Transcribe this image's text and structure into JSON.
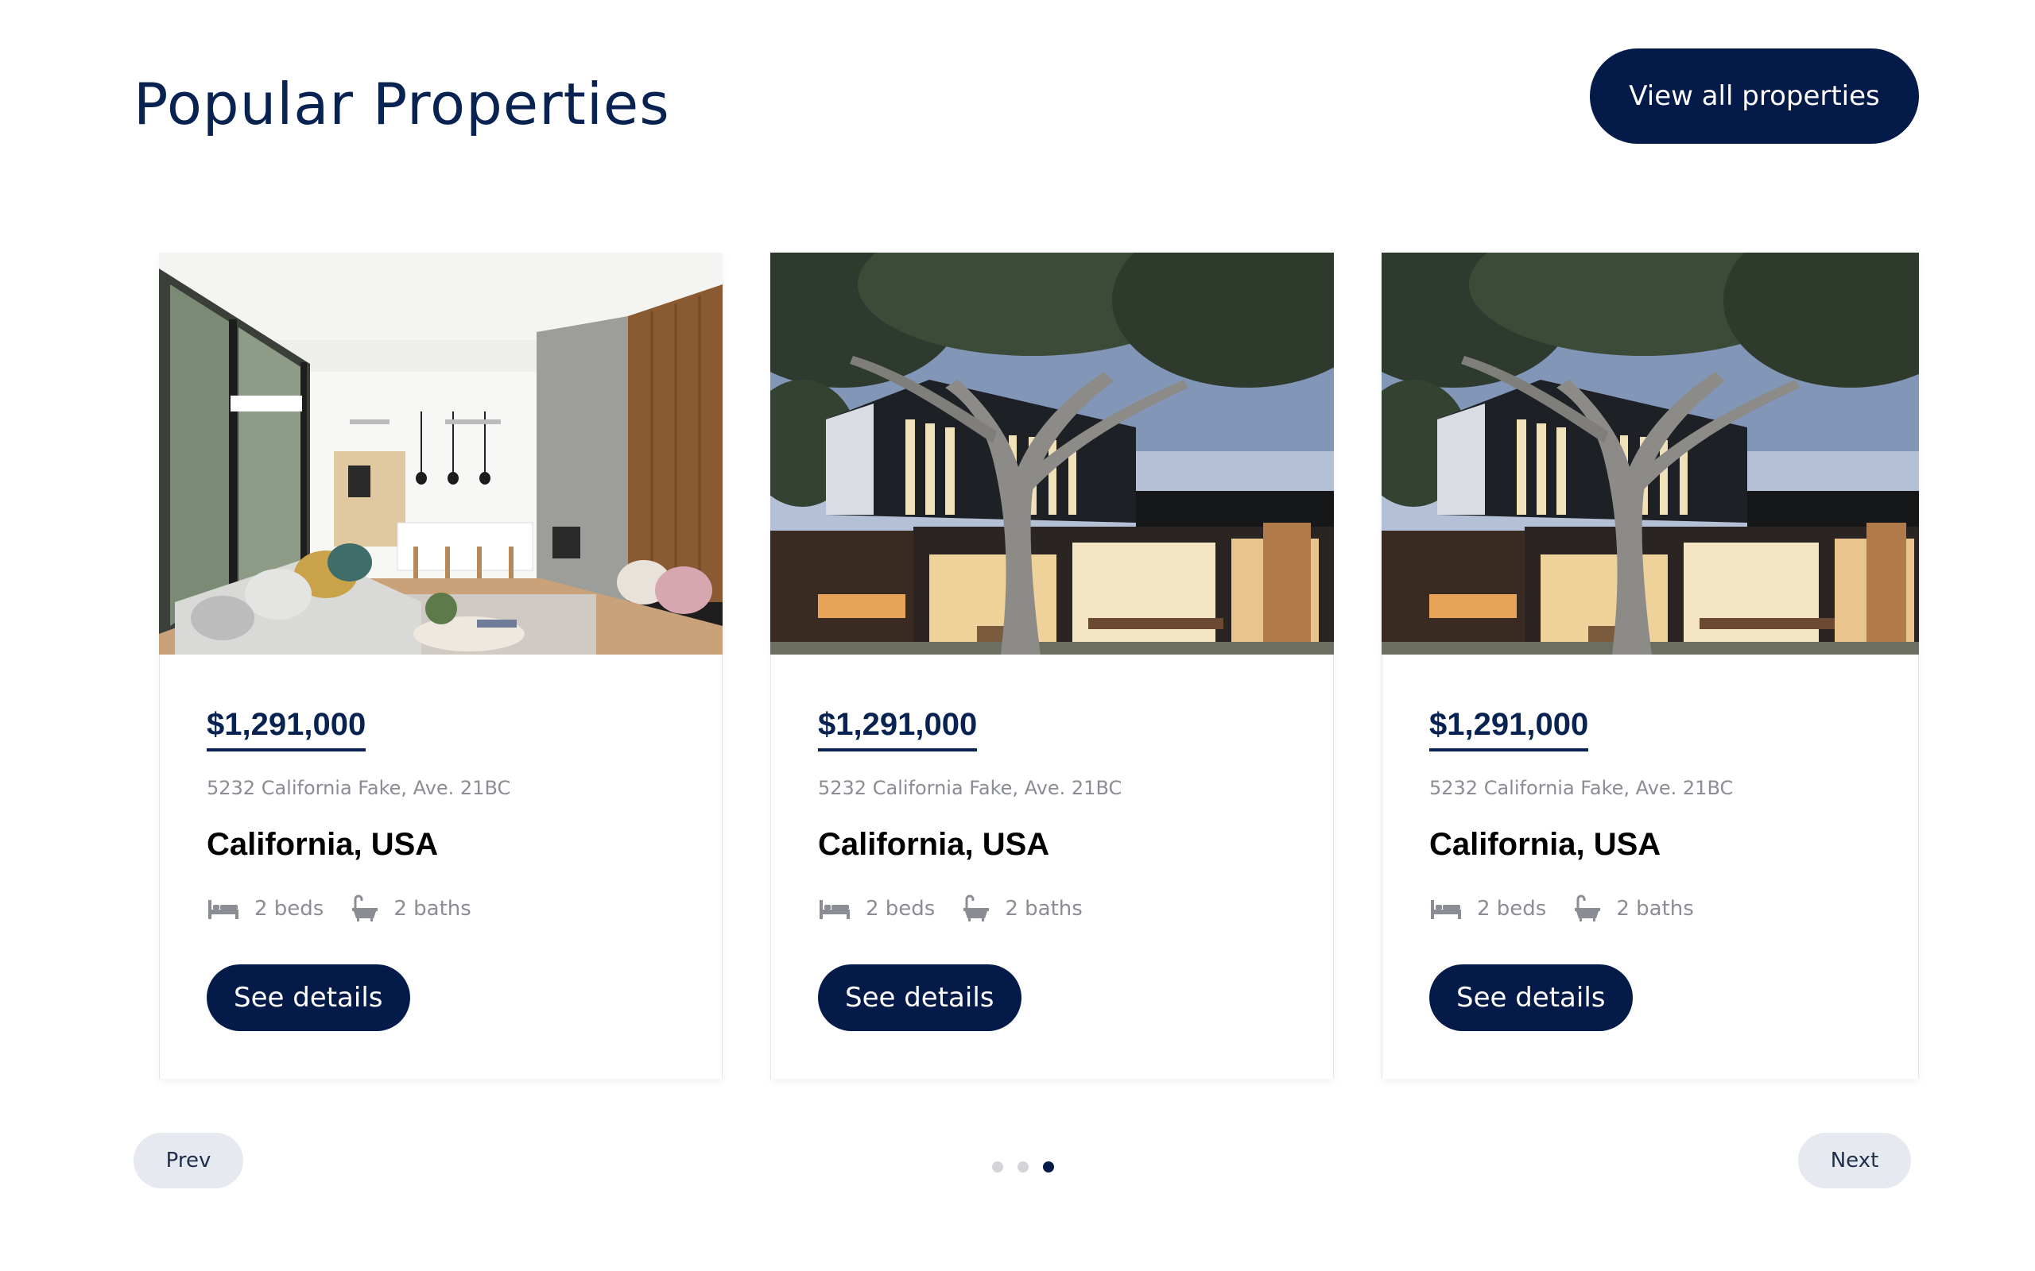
{
  "header": {
    "title": "Popular Properties",
    "view_all_label": "View all properties"
  },
  "cards": [
    {
      "image": "interior-living-room",
      "price": "$1,291,000",
      "address": "5232 California Fake, Ave. 21BC",
      "city": "California, USA",
      "beds": "2 beds",
      "baths": "2 baths",
      "button_label": "See details"
    },
    {
      "image": "modern-house-exterior",
      "price": "$1,291,000",
      "address": "5232 California Fake, Ave. 21BC",
      "city": "California, USA",
      "beds": "2 beds",
      "baths": "2 baths",
      "button_label": "See details"
    },
    {
      "image": "modern-house-exterior",
      "price": "$1,291,000",
      "address": "5232 California Fake, Ave. 21BC",
      "city": "California, USA",
      "beds": "2 beds",
      "baths": "2 baths",
      "button_label": "See details"
    }
  ],
  "pagination": {
    "prev_label": "Prev",
    "next_label": "Next",
    "total_dots": 3,
    "active_dot": 3
  },
  "icons": {
    "bed": "bed-icon",
    "bath": "bath-icon"
  },
  "colors": {
    "primary": "#041b4a",
    "heading": "#082251",
    "muted_text": "#8a8d93",
    "pager_bg": "#e6e9ef",
    "dot_inactive": "#d2d4d8"
  }
}
